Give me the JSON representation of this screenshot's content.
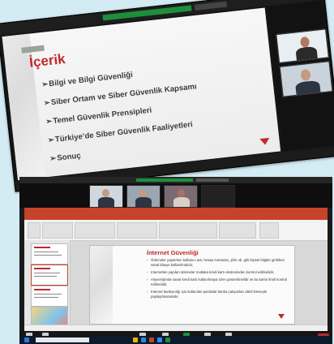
{
  "colors": {
    "background": "#d3ebf3",
    "green": "#1d8f3c",
    "accent_red": "#c0282a",
    "ppt_orange": "#c5432a"
  },
  "top_slide": {
    "title": "İçerik",
    "items": [
      "Bilgi ve Bilgi Güvenliği",
      "Siber Ortam ve Siber Güvenlik Kapsamı",
      "Temel Güvenlik Prensipleri",
      "Türkiye’de Siber Güvenlik Faaliyetleri",
      "Sonuç"
    ]
  },
  "bottom_slide": {
    "title": "İnternet Güvenliği",
    "bullets": [
      "Ödemeler yapılırken kullanıcı adı, hesap numarası, şifre vb. gibi kişisel bilgiler girilirken sanal klavye kullanılmalıdır,",
      "Internetten yapılan ödemeler mutlaka kredi kartı ekstresinden kontrol edilmelidir,",
      "Alışverişlerde sanal kredi kartı kullanılmaya özen gösterilmelidir ve bu kartın limiti kontrol edilmelidir,",
      "İnternet bankacılığı için kullanılan parolalar banka çalışanları dahil kimseyle paylaşılmamalıdır."
    ]
  },
  "icons": [
    "microphone-icon",
    "video-icon",
    "participants-icon",
    "share-screen-icon",
    "reactions-icon",
    "end-call-icon",
    "windows-start-icon",
    "search-icon"
  ]
}
